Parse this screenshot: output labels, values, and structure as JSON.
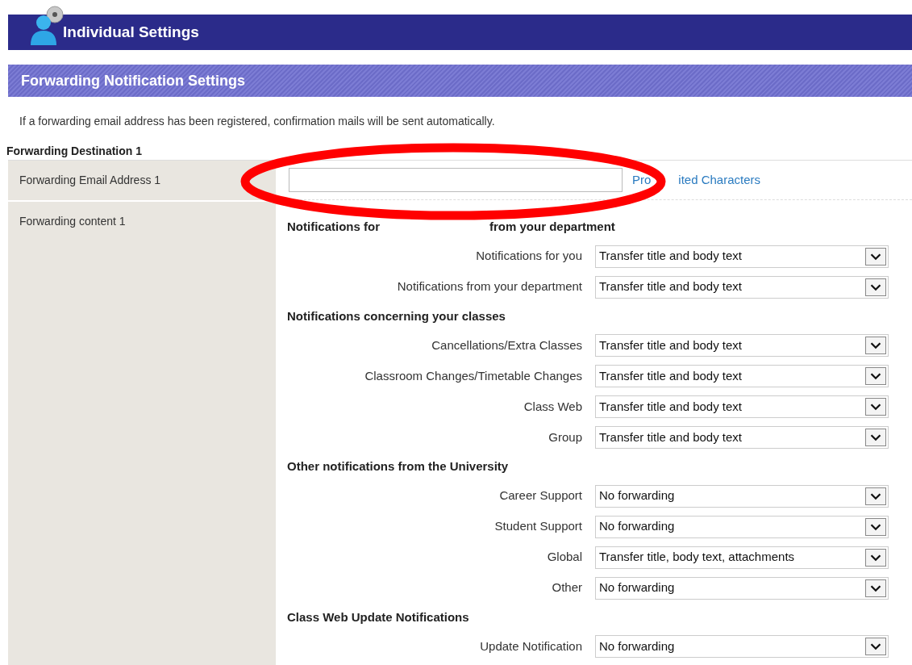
{
  "header": {
    "title": "Individual Settings"
  },
  "section": {
    "title": "Forwarding Notification Settings"
  },
  "description": "If a forwarding email address has been registered, confirmation mails will be sent automatically.",
  "destination": {
    "title": "Forwarding Destination 1",
    "email_row": {
      "label": "Forwarding Email Address 1",
      "link_parts": [
        "Pro",
        "ited Characters"
      ]
    },
    "content_row": {
      "label": "Forwarding content 1",
      "groups": [
        {
          "heading_parts": [
            "Notifications for",
            "from your department"
          ],
          "items": [
            {
              "label": "Notifications for you",
              "value": "Transfer title and body text"
            },
            {
              "label": "Notifications from your department",
              "value": "Transfer title and body text"
            }
          ]
        },
        {
          "heading": "Notifications concerning your classes",
          "items": [
            {
              "label": "Cancellations/Extra Classes",
              "value": "Transfer title and body text"
            },
            {
              "label": "Classroom Changes/Timetable Changes",
              "value": "Transfer title and body text"
            },
            {
              "label": "Class Web",
              "value": "Transfer title and body text"
            },
            {
              "label": "Group",
              "value": "Transfer title and body text"
            }
          ]
        },
        {
          "heading": "Other notifications from the University",
          "items": [
            {
              "label": "Career Support",
              "value": "No forwarding"
            },
            {
              "label": "Student Support",
              "value": "No forwarding"
            },
            {
              "label": "Global",
              "value": "Transfer title, body text, attachments"
            },
            {
              "label": "Other",
              "value": "No forwarding"
            }
          ]
        },
        {
          "heading": "Class Web Update Notifications",
          "items": [
            {
              "label": "Update Notification",
              "value": "No forwarding"
            }
          ]
        }
      ]
    }
  }
}
